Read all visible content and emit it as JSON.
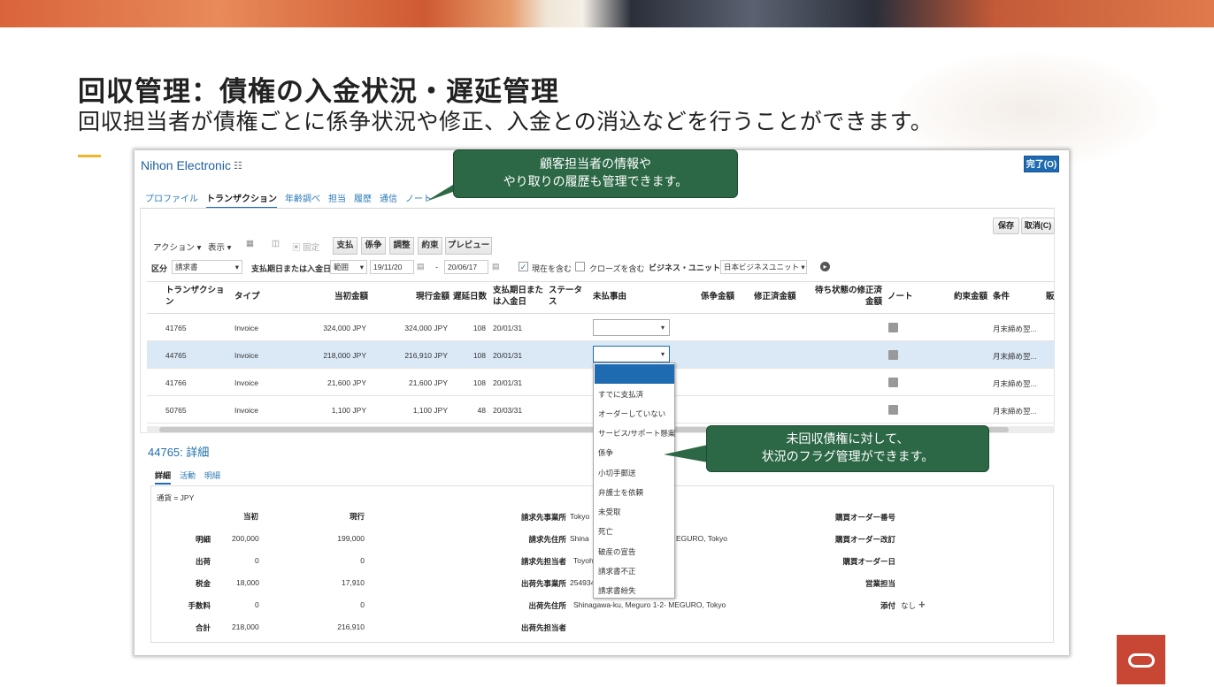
{
  "slide": {
    "title": "回収管理：債権の入金状況・遅延管理",
    "subtitle": "回収担当者が債権ごとに係争状況や修正、入金との消込などを行うことができます。"
  },
  "callouts": {
    "customer_lines": [
      "顧客担当者の情報や",
      "やり取りの履歴も管理できます。"
    ],
    "flag_lines": [
      "未回収債権に対して、",
      "状況のフラグ管理ができます。"
    ]
  },
  "app": {
    "customer_name": "Nihon Electronic",
    "done_label": "完了(O)",
    "tabs": [
      "プロファイル",
      "トランザクション",
      "年齢調べ",
      "担当",
      "履歴",
      "通信",
      "ノート"
    ],
    "active_tab": "トランザクション",
    "save_label": "保存",
    "cancel_label": "取消(C)",
    "toolbar": {
      "action": "アクション ▾",
      "view": "表示 ▾",
      "freeze": "固定",
      "buttons": [
        "支払",
        "係争",
        "調整",
        "約束",
        "プレビュー"
      ]
    },
    "filters": {
      "class_label": "区分",
      "class_value": "請求書",
      "date_label": "支払期日または入金日",
      "range_value": "範囲",
      "date_from": "19/11/20",
      "dash": "-",
      "date_to": "20/06/17",
      "include_current": "現在を含む",
      "include_closed": "クローズを含む",
      "bu_label": "ビジネス・ユニット",
      "bu_value": "日本ビジネスユニット"
    },
    "columns": [
      "トランザクション",
      "タイプ",
      "当初金額",
      "現行金額",
      "遅延日数",
      "支払期日または入金日",
      "ステータス",
      "未払事由",
      "係争金額",
      "修正済金額",
      "待ち状態の修正済金額",
      "ノート",
      "約束金額",
      "条件",
      "販"
    ],
    "rows": [
      {
        "id": "41765",
        "type": "Invoice",
        "original": "324,000 JPY",
        "current": "324,000 JPY",
        "days": "108",
        "date": "20/01/31",
        "terms": "月末締め翌..."
      },
      {
        "id": "44765",
        "type": "Invoice",
        "original": "218,000 JPY",
        "current": "216,910 JPY",
        "days": "108",
        "date": "20/01/31",
        "terms": "月末締め翌..."
      },
      {
        "id": "41766",
        "type": "Invoice",
        "original": "21,600 JPY",
        "current": "21,600 JPY",
        "days": "108",
        "date": "20/01/31",
        "terms": "月末締め翌..."
      },
      {
        "id": "50765",
        "type": "Invoice",
        "original": "1,100 JPY",
        "current": "1,100 JPY",
        "days": "48",
        "date": "20/03/31",
        "terms": "月末締め翌..."
      }
    ],
    "reasons": [
      "すでに支払済",
      "オーダーしていない",
      "サービス/サポート懸案",
      "係争",
      "小切手郵送",
      "弁護士を依頼",
      "未受取",
      "死亡",
      "破産の宣告",
      "請求書不正",
      "請求書紛失"
    ],
    "detail": {
      "title": "44765: 詳細",
      "tabs": [
        "詳細",
        "活動",
        "明細"
      ],
      "currency": "通貨 = JPY",
      "col_original": "当初",
      "col_current": "現行",
      "lines": [
        {
          "label": "明細",
          "original": "200,000",
          "current": "199,000"
        },
        {
          "label": "出荷",
          "original": "0",
          "current": "0"
        },
        {
          "label": "税金",
          "original": "18,000",
          "current": "17,910"
        },
        {
          "label": "手数料",
          "original": "0",
          "current": "0"
        },
        {
          "label": "合計",
          "original": "218,000",
          "current": "216,910"
        }
      ],
      "bill_site_label": "請求先事業所",
      "bill_site": "Tokyo",
      "bill_addr_label": "請求先住所",
      "bill_addr_a": "Shina",
      "bill_addr_b": "EGURO, Tokyo",
      "bill_contact_label": "請求先担当者",
      "bill_contact": "Toyoh",
      "ship_site_label": "出荷先事業所",
      "ship_site": "254934",
      "ship_addr_label": "出荷先住所",
      "ship_addr": "Shinagawa-ku, Meguro 1-2- MEGURO, Tokyo",
      "ship_contact_label": "出荷先担当者",
      "po_label": "購買オーダー番号",
      "po_rev_label": "購買オーダー改訂",
      "po_date_label": "購買オーダー日",
      "sales_label": "営業担当",
      "attach_label": "添付",
      "attach_value": "なし"
    }
  },
  "colors": {
    "brand": "#c74634",
    "callout": "#2c6846",
    "link": "#1e6fae",
    "selected_row": "#dbe9f7"
  }
}
